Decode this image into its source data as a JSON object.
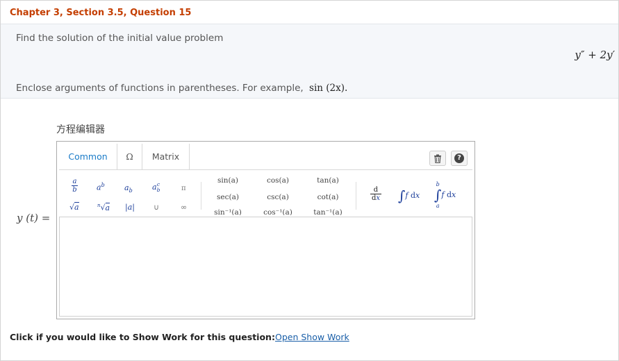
{
  "question": {
    "title": "Chapter 3, Section 3.5, Question 15",
    "prompt": "Find the solution of the initial value problem",
    "equation": "y″ + 2y′",
    "hint_text": "Enclose arguments of functions in parentheses. For example,",
    "hint_example": "sin (2x)."
  },
  "editor": {
    "title": "方程编辑器",
    "tabs": [
      "Common",
      "Ω",
      "Matrix"
    ],
    "active_tab": "Common",
    "toolbar_icons": [
      "trash-icon",
      "help-icon"
    ],
    "help_label": "?",
    "palette_row1": [
      "a/b",
      "aᵇ",
      "a_b",
      "a_b^c",
      "π"
    ],
    "palette_row2": [
      "√a",
      "ⁿ√a",
      "|a|",
      "∪",
      "∞"
    ],
    "functions_row1": [
      "sin(a)",
      "cos(a)",
      "tan(a)"
    ],
    "functions_row2": [
      "sec(a)",
      "csc(a)",
      "cot(a)"
    ],
    "functions_row3": [
      "sin⁻¹(a)",
      "cos⁻¹(a)",
      "tan⁻¹(a)"
    ],
    "calculus": [
      "d/dx",
      "∫f dx",
      "∫ₐᵇf dx"
    ],
    "answer_label": "y (t) ="
  },
  "footer": {
    "show_work_text": "Click if you would like to Show Work for this question:",
    "show_work_link": "Open Show Work"
  },
  "colors": {
    "title": "#c43e00",
    "link": "#1a5fa8",
    "active_tab": "#1a7bc8",
    "symbol": "#1c3e9a"
  }
}
